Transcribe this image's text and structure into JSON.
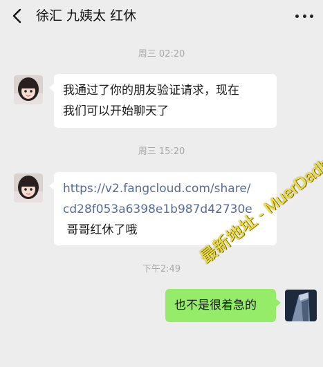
{
  "header": {
    "title": "徐汇 九姨太 红休",
    "back_icon": "chevron-left-icon",
    "more_icon": "more-dots-icon"
  },
  "messages": [
    {
      "type": "timestamp",
      "text": "周三 02:20"
    },
    {
      "type": "text",
      "from": "other",
      "text_lines": [
        "我通过了你的朋友验证请求，现在",
        "我们可以开始聊天了"
      ]
    },
    {
      "type": "timestamp",
      "text": "周三 15:20"
    },
    {
      "type": "link",
      "from": "other",
      "link_lines": [
        "https://v2.fangcloud.com/share/",
        "cd28f053a6398e1b987d42730e"
      ],
      "tail": " 哥哥红休了哦"
    },
    {
      "type": "timestamp",
      "text": "下午2:49"
    },
    {
      "type": "text",
      "from": "me",
      "text": "也不是很着急的"
    }
  ],
  "watermark": {
    "text": "最新地址 - MuerDadhang.Com"
  },
  "colors": {
    "background": "#ededed",
    "bubble_other": "#ffffff",
    "bubble_me": "#95ec69",
    "link": "#576b95",
    "timestamp": "#a8a8a8"
  }
}
